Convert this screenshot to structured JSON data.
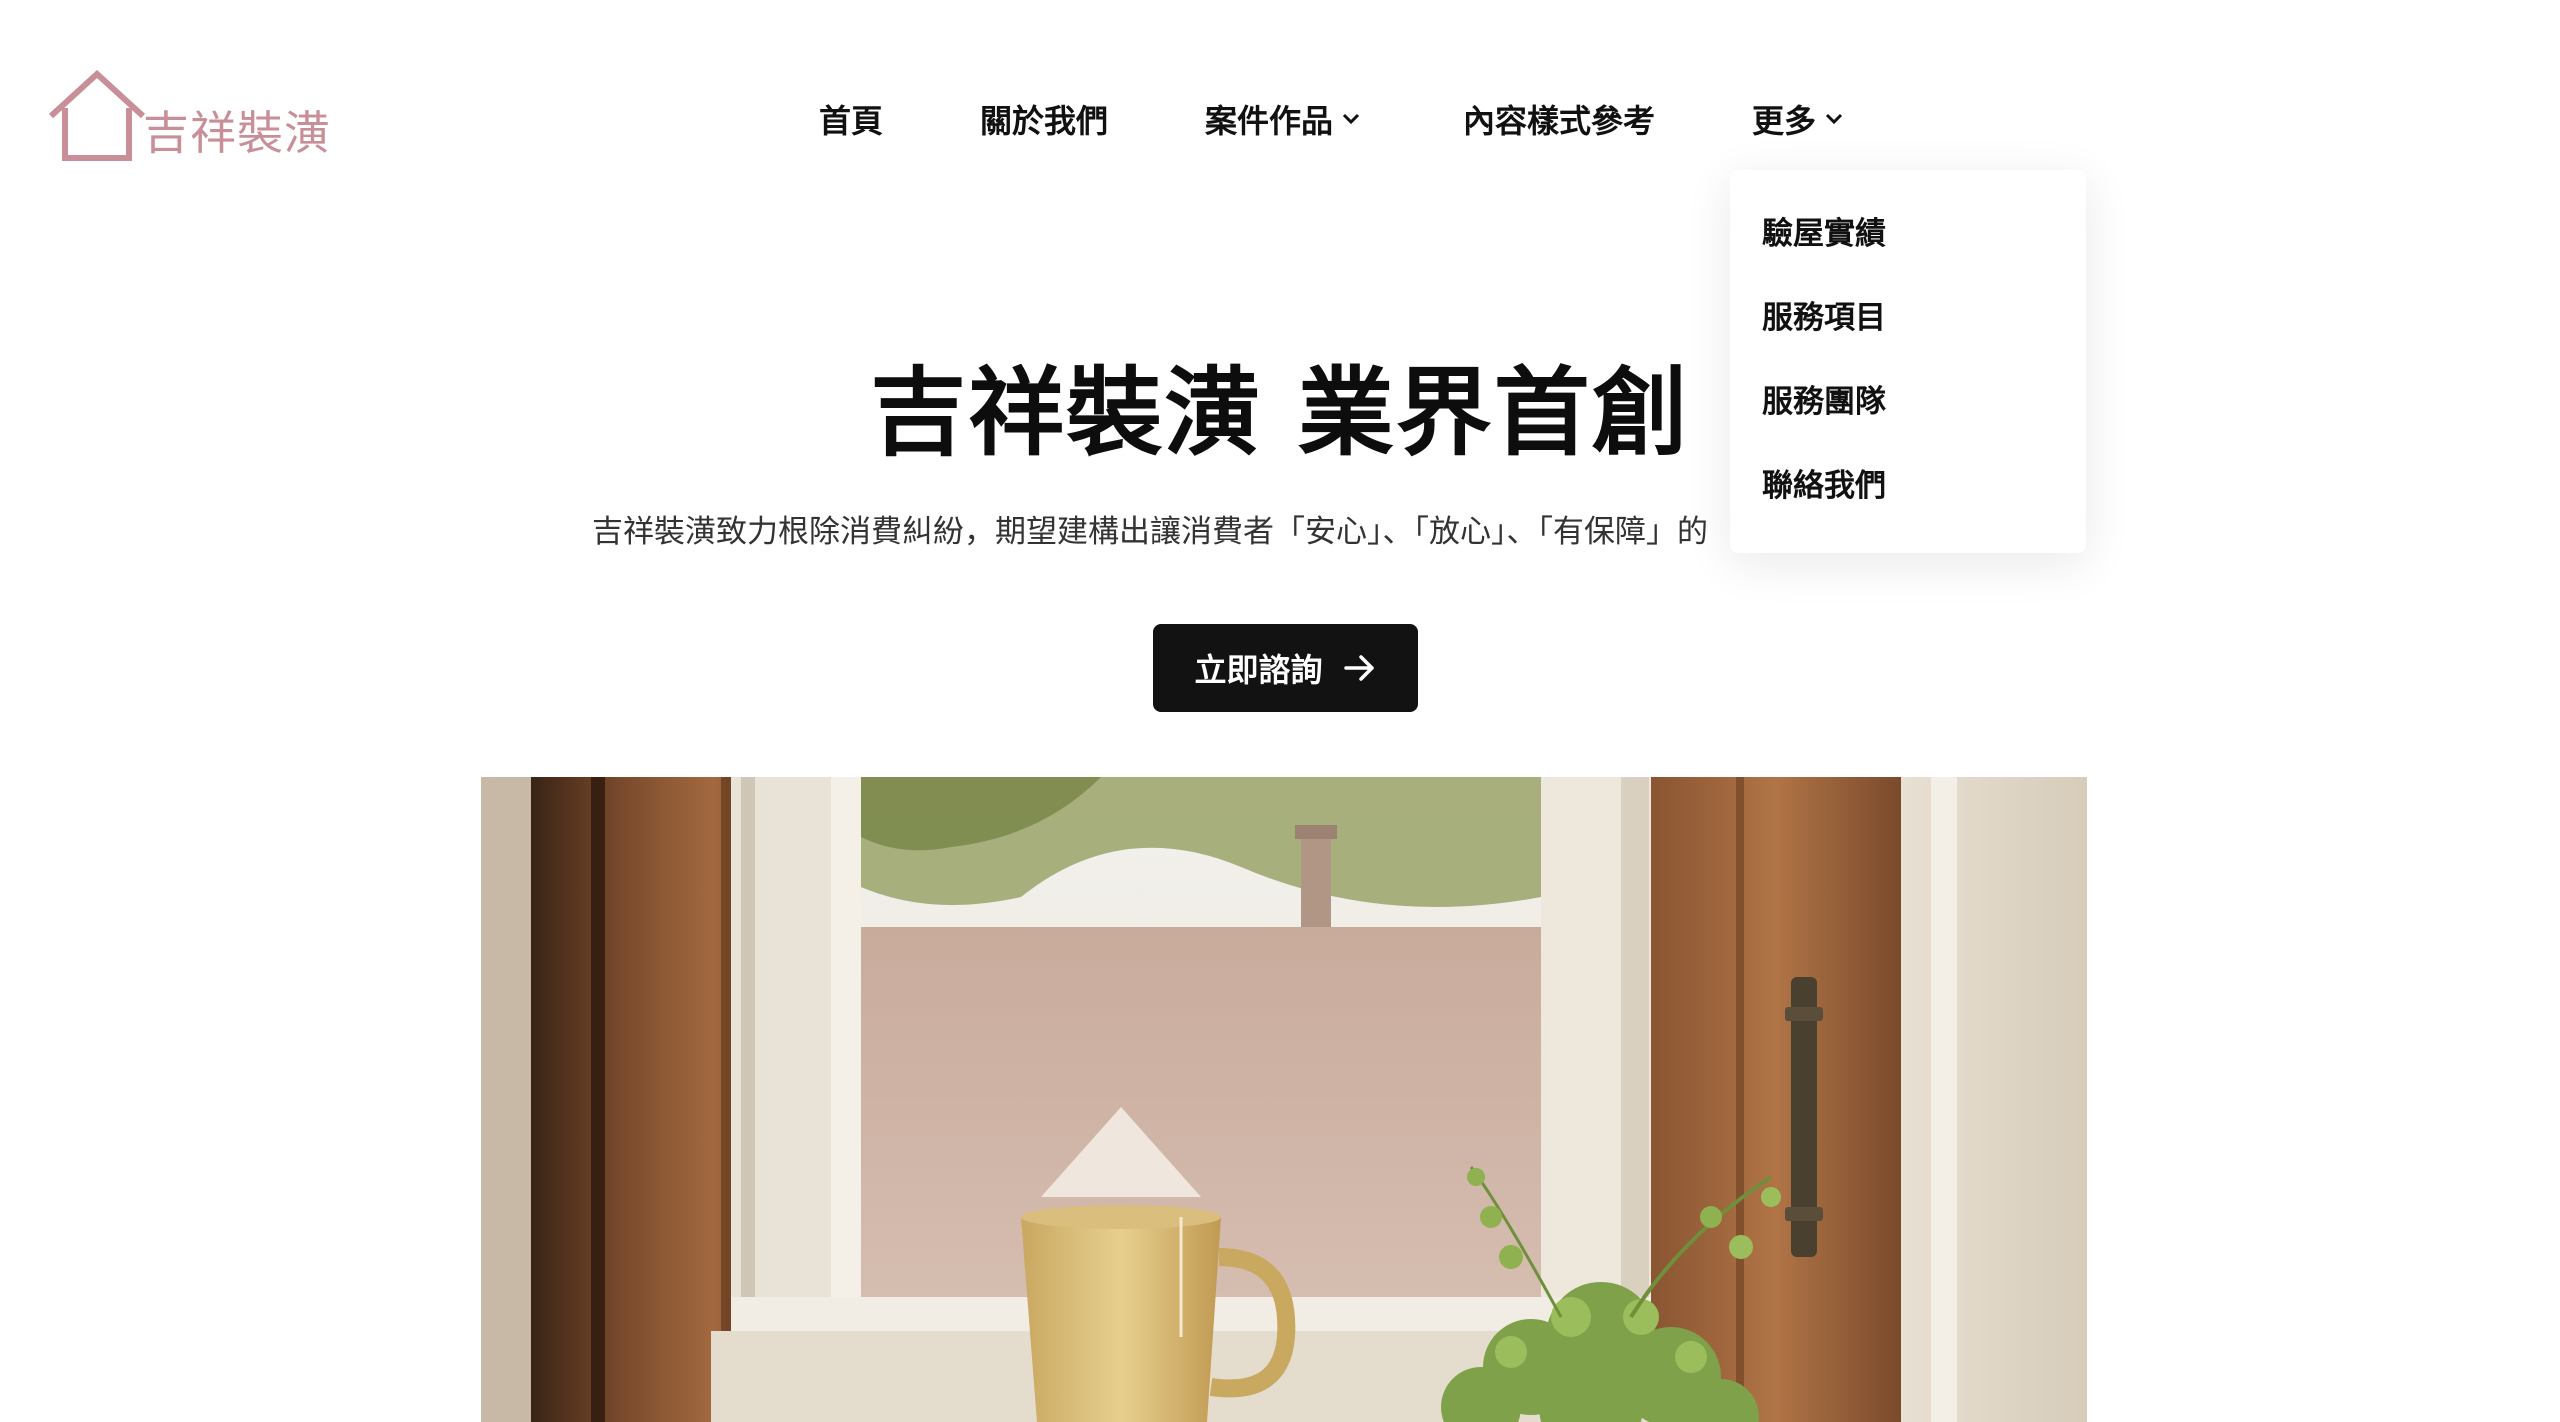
{
  "logo": {
    "text": "吉祥裝潢",
    "color": "#c98f98"
  },
  "nav": {
    "items": [
      {
        "label": "首頁",
        "has_dropdown": false
      },
      {
        "label": "關於我們",
        "has_dropdown": false
      },
      {
        "label": "案件作品",
        "has_dropdown": true
      },
      {
        "label": "內容樣式參考",
        "has_dropdown": false
      },
      {
        "label": "更多",
        "has_dropdown": true
      }
    ],
    "chevron_icon": "chevron-down-icon"
  },
  "dropdown": {
    "parent": "更多",
    "items": [
      {
        "label": "驗屋實績"
      },
      {
        "label": "服務項目"
      },
      {
        "label": "服務團隊"
      },
      {
        "label": "聯絡我們"
      }
    ]
  },
  "hero": {
    "title": "吉祥裝潢 業界首創",
    "subtitle": "吉祥裝潢致力根除消費糾紛，期望建構出讓消費者「安心」、「放心」、「有保障」的",
    "cta_label": "立即諮詢",
    "cta_icon": "arrow-right-icon",
    "cta_bg": "#121212"
  },
  "image": {
    "subject": "wooden window frame with a yellow mug and a potted plant on the sill"
  }
}
